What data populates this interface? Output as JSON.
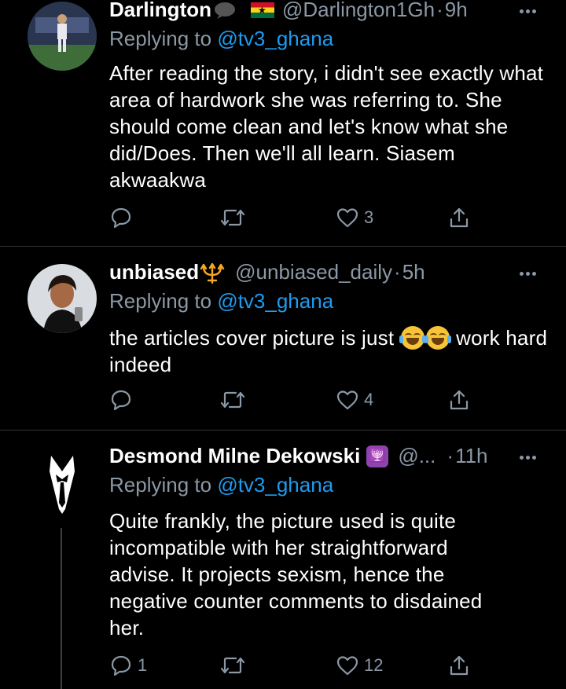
{
  "tweets": [
    {
      "name": "Darlington",
      "handle": "@Darlington1Gh",
      "time": "9h",
      "replying_prefix": "Replying to",
      "replying_to": "@tv3_ghana",
      "text": "After reading the story, i didn't see exactly what area of hardwork she was referring to. She should come clean and let's know what she did/Does. Then we'll all learn. Siasem akwaakwa",
      "replies": "",
      "retweets": "",
      "likes": "3",
      "badge_icons": [
        "speech-bubble-icon",
        "ghana-flag-icon"
      ]
    },
    {
      "name": "unbiased",
      "handle": "@unbiased_daily",
      "time": "5h",
      "replying_prefix": "Replying to",
      "replying_to": "@tv3_ghana",
      "text_before": "the articles cover picture is just",
      "text_after": "work hard indeed",
      "replies": "",
      "retweets": "",
      "likes": "4",
      "badge_icons": [
        "trident-icon"
      ],
      "emoji_icons": [
        "laughing-tears-emoji",
        "laughing-tears-emoji"
      ]
    },
    {
      "name": "Desmond Milne Dekowski",
      "handle": "@...",
      "time": "11h",
      "replying_prefix": "Replying to",
      "replying_to": "@tv3_ghana",
      "text": "Quite frankly, the picture used is quite incompatible with her straightforward advise. It projects sexism, hence the negative counter comments to disdained her.",
      "replies": "1",
      "retweets": "",
      "likes": "12",
      "badge_icons": [
        "menorah-icon"
      ]
    }
  ],
  "colors": {
    "background": "#000000",
    "text": "#ffffff",
    "secondary": "#8b98a5",
    "link": "#1d9bf0",
    "divider": "#2f3336"
  }
}
